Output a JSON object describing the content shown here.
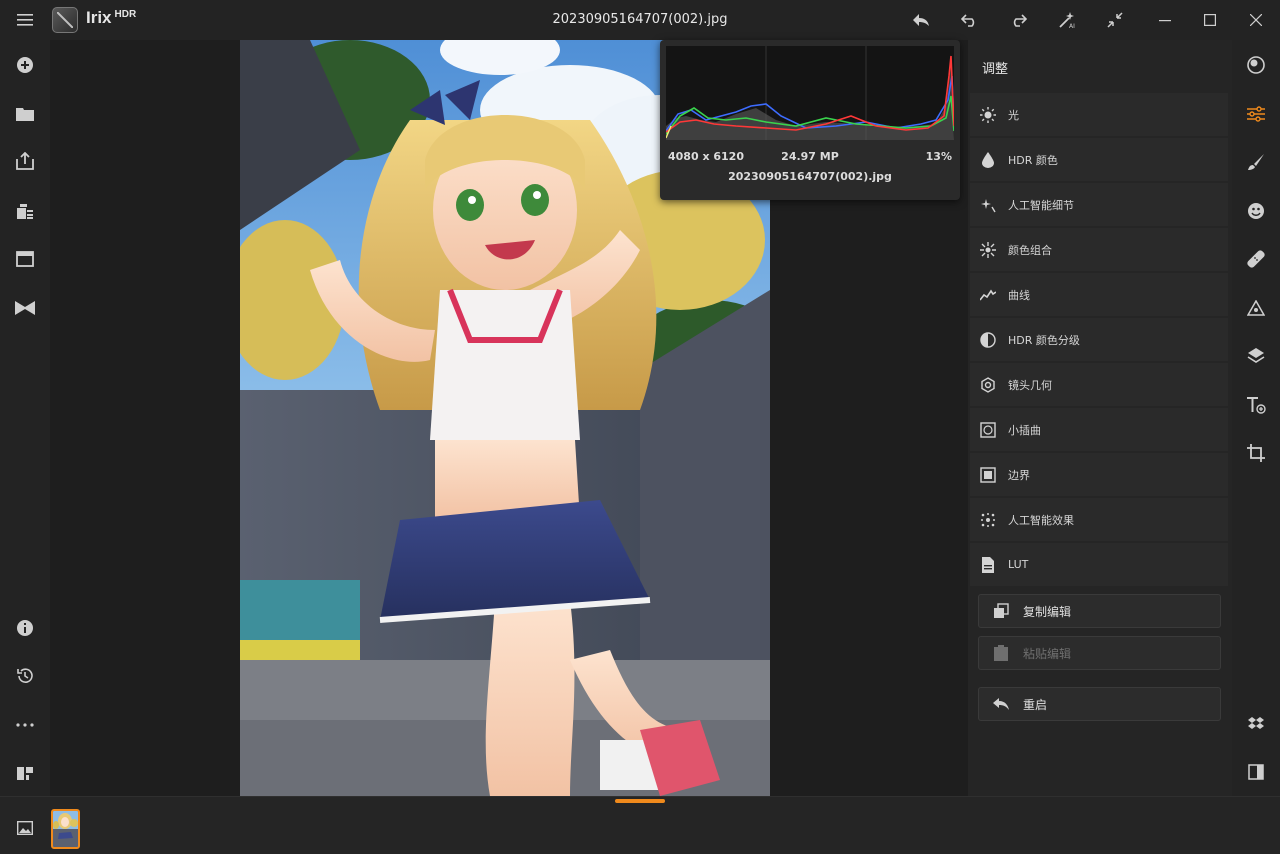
{
  "app": {
    "name": "Irix",
    "name_sup": "HDR",
    "filename": "20230905164707(002).jpg"
  },
  "titlebar_icons": [
    "menu-icon",
    "share-back-icon",
    "undo-icon",
    "redo-icon",
    "ai-magic-icon",
    "collapse-icon",
    "minimize-icon",
    "maximize-icon",
    "close-icon"
  ],
  "left_toolbar": [
    "add-icon",
    "folder-icon",
    "export-icon",
    "batch-icon",
    "window-icon",
    "bowtie-icon",
    "info-icon",
    "history-icon",
    "more-icon",
    "gift-icon"
  ],
  "histogram": {
    "resolution": "4080 x 6120",
    "megapixels": "24.97 MP",
    "zoom": "13%",
    "filename": "20230905164707(002).jpg"
  },
  "panel": {
    "title": "调整",
    "items": [
      {
        "label": "光",
        "icon": "sun-icon"
      },
      {
        "label": "HDR 颜色",
        "icon": "drop-icon"
      },
      {
        "label": "人工智能细节",
        "icon": "sparkle-icon"
      },
      {
        "label": "颜色组合",
        "icon": "color-mix-icon"
      },
      {
        "label": "曲线",
        "icon": "curve-icon"
      },
      {
        "label": "HDR 颜色分级",
        "icon": "color-grade-icon"
      },
      {
        "label": "镜头几何",
        "icon": "lens-icon"
      },
      {
        "label": "小插曲",
        "icon": "vignette-icon"
      },
      {
        "label": "边界",
        "icon": "border-icon"
      },
      {
        "label": "人工智能效果",
        "icon": "ai-effect-icon"
      },
      {
        "label": "LUT",
        "icon": "lut-file-icon"
      }
    ],
    "copy_edit": "复制编辑",
    "paste_edit": "粘贴编辑",
    "reset": "重启"
  },
  "right_toolbar": [
    "presets-icon",
    "adjust-sliders-icon",
    "brush-icon",
    "face-icon",
    "heal-icon",
    "triangle-icon",
    "layers-icon",
    "text-add-icon",
    "crop-icon",
    "dropbox-icon",
    "compare-icon"
  ],
  "accent_color": "#f08a1c"
}
